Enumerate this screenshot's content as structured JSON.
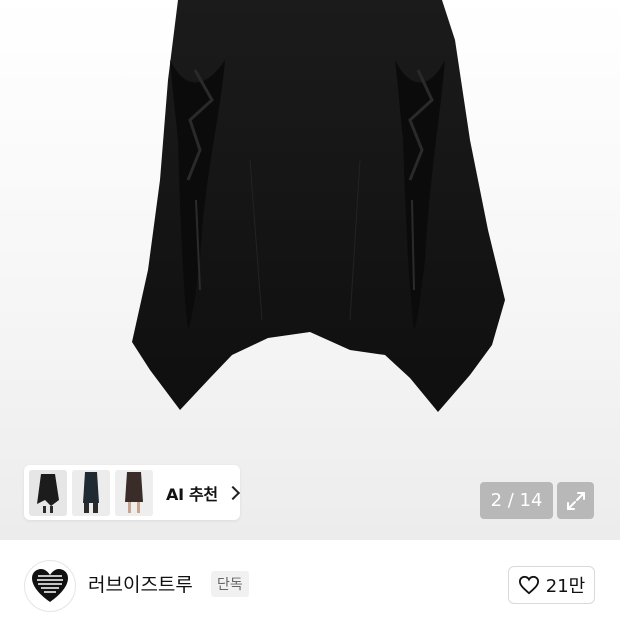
{
  "gallery": {
    "ai_recommend_label": "AI 추천",
    "counter_text": "2 / 14",
    "expand_icon": "expand-arrows-icon",
    "thumbnails": [
      {
        "name": "thumb-black-skirt"
      },
      {
        "name": "thumb-denim-skirt"
      },
      {
        "name": "thumb-dark-skirt"
      }
    ]
  },
  "brand": {
    "logo_text": "LOVESTRUE",
    "name": "러브이즈트루",
    "badge": "단독"
  },
  "like": {
    "icon": "heart-icon",
    "count": "21만"
  }
}
